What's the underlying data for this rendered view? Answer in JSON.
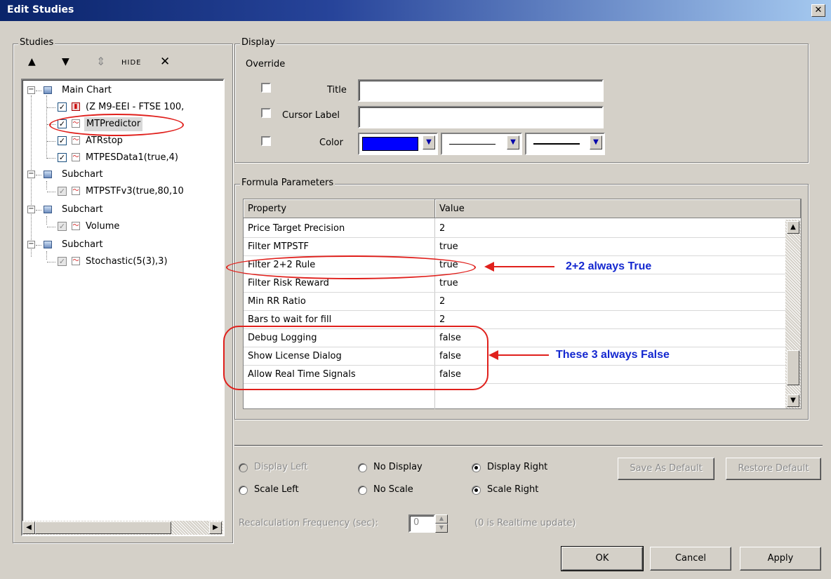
{
  "window": {
    "title": "Edit Studies",
    "close_glyph": "✕"
  },
  "studies_panel": {
    "legend": "Studies",
    "toolbar": {
      "up": "▲",
      "down": "▼",
      "updown": "⇕",
      "hide": "HIDE",
      "delete": "✕"
    },
    "tree": [
      {
        "label": "Main Chart",
        "type": "group"
      },
      {
        "label": "(Z M9-EEI - FTSE 100,",
        "type": "study",
        "checked": true
      },
      {
        "label": "MTPredictor",
        "type": "study",
        "checked": true,
        "selected": true
      },
      {
        "label": "ATRstop",
        "type": "study",
        "checked": true
      },
      {
        "label": "MTPESData1(true,4)",
        "type": "study",
        "checked": true
      },
      {
        "label": "Subchart",
        "type": "group"
      },
      {
        "label": "MTPSTFv3(true,80,10",
        "type": "study",
        "checked": true
      },
      {
        "label": "Subchart",
        "type": "group"
      },
      {
        "label": "Volume",
        "type": "study",
        "checked": true
      },
      {
        "label": "Subchart",
        "type": "group"
      },
      {
        "label": "Stochastic(5(3),3)",
        "type": "study",
        "checked": true
      }
    ]
  },
  "display_panel": {
    "legend": "Display",
    "override_label": "Override",
    "title_label": "Title",
    "cursor_label": "Cursor Label",
    "color_label": "Color",
    "color_value": "#0000ff"
  },
  "formula_panel": {
    "legend": "Formula Parameters",
    "columns": [
      "Property",
      "Value"
    ],
    "rows": [
      {
        "property": "Price Target Precision",
        "value": "2"
      },
      {
        "property": "Filter MTPSTF",
        "value": "true"
      },
      {
        "property": "Filter 2+2 Rule",
        "value": "true"
      },
      {
        "property": "Filter Risk Reward",
        "value": "true"
      },
      {
        "property": "Min RR Ratio",
        "value": "2"
      },
      {
        "property": "Bars to wait for fill",
        "value": "2"
      },
      {
        "property": "Debug Logging",
        "value": "false"
      },
      {
        "property": "Show License Dialog",
        "value": "false"
      },
      {
        "property": "Allow Real Time Signals",
        "value": "false"
      }
    ]
  },
  "annotations": {
    "note1": "2+2 always True",
    "note2": "These 3 always False"
  },
  "options": {
    "display_left": "Display Left",
    "no_display": "No Display",
    "display_right": "Display Right",
    "scale_left": "Scale Left",
    "no_scale": "No Scale",
    "scale_right": "Scale Right",
    "recalc_label": "Recalculation Frequency (sec):",
    "recalc_value": "0",
    "recalc_hint": "(0 is Realtime update)"
  },
  "buttons": {
    "save_default": "Save As Default",
    "restore_default": "Restore Default",
    "ok": "OK",
    "cancel": "Cancel",
    "apply": "Apply"
  },
  "colors": {
    "accent": "#0a246a",
    "annotation_red": "#e0201c",
    "annotation_blue": "#1428d0"
  }
}
